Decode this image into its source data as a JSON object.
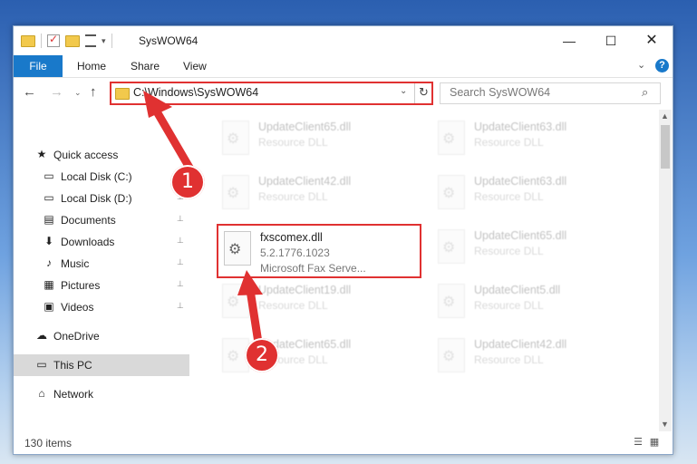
{
  "window": {
    "title": "SysWOW64",
    "controls": {
      "minimize": "—",
      "maximize": "☐",
      "close": "✕"
    }
  },
  "ribbon": {
    "tabs": [
      "File",
      "Home",
      "Share",
      "View"
    ],
    "collapse": "⌄",
    "help": "?"
  },
  "navigation": {
    "back": "←",
    "forward": "→",
    "recent": "⌄",
    "up": "↑",
    "address": "C:\\Windows\\SysWOW64",
    "address_dropdown": "⌄",
    "refresh": "↻",
    "search_placeholder": "Search SysWOW64",
    "search_icon": "⌕"
  },
  "sidebar": {
    "items": [
      {
        "label": "Quick access",
        "icon": "★",
        "icon_name": "star-icon",
        "pinned": false
      },
      {
        "label": "Local Disk (C:)",
        "icon": "▭",
        "icon_name": "drive-icon",
        "pinned": true
      },
      {
        "label": "Local Disk (D:)",
        "icon": "▭",
        "icon_name": "drive-icon",
        "pinned": true
      },
      {
        "label": "Documents",
        "icon": "▤",
        "icon_name": "documents-icon",
        "pinned": true
      },
      {
        "label": "Downloads",
        "icon": "⬇",
        "icon_name": "download-icon",
        "pinned": true
      },
      {
        "label": "Music",
        "icon": "♪",
        "icon_name": "music-icon",
        "pinned": true
      },
      {
        "label": "Pictures",
        "icon": "▦",
        "icon_name": "pictures-icon",
        "pinned": true
      },
      {
        "label": "Videos",
        "icon": "▣",
        "icon_name": "videos-icon",
        "pinned": true
      },
      {
        "label": "OneDrive",
        "icon": "☁",
        "icon_name": "cloud-icon",
        "pinned": false
      },
      {
        "label": "This PC",
        "icon": "▭",
        "icon_name": "computer-icon",
        "pinned": false,
        "selected": true
      },
      {
        "label": "Network",
        "icon": "⌂",
        "icon_name": "network-icon",
        "pinned": false
      }
    ],
    "pin_glyph": "📌"
  },
  "files": [
    {
      "name": "UpdateClient65.dll",
      "desc": "Resource DLL",
      "faded": true
    },
    {
      "name": "UpdateClient63.dll",
      "desc": "Resource DLL",
      "faded": true
    },
    {
      "name": "UpdateClient42.dll",
      "desc": "Resource DLL",
      "faded": true
    },
    {
      "name": "UpdateClient63.dll",
      "desc": "Resource DLL",
      "faded": true
    },
    {
      "name": "fxscomex.dll",
      "desc": "5.2.1776.1023",
      "desc2": "Microsoft Fax Serve...",
      "faded": false,
      "selected": true
    },
    {
      "name": "UpdateClient65.dll",
      "desc": "Resource DLL",
      "faded": true
    },
    {
      "name": "UpdateClient19.dll",
      "desc": "Resource DLL",
      "faded": true
    },
    {
      "name": "UpdateClient5.dll",
      "desc": "Resource DLL",
      "faded": true
    },
    {
      "name": "UpdateClient65.dll",
      "desc": "Resource DLL",
      "faded": true
    },
    {
      "name": "UpdateClient42.dll",
      "desc": "Resource DLL",
      "faded": true
    }
  ],
  "status": {
    "item_count": "130 items"
  },
  "annotations": {
    "step1": "1",
    "step2": "2",
    "color": "#e03131"
  }
}
